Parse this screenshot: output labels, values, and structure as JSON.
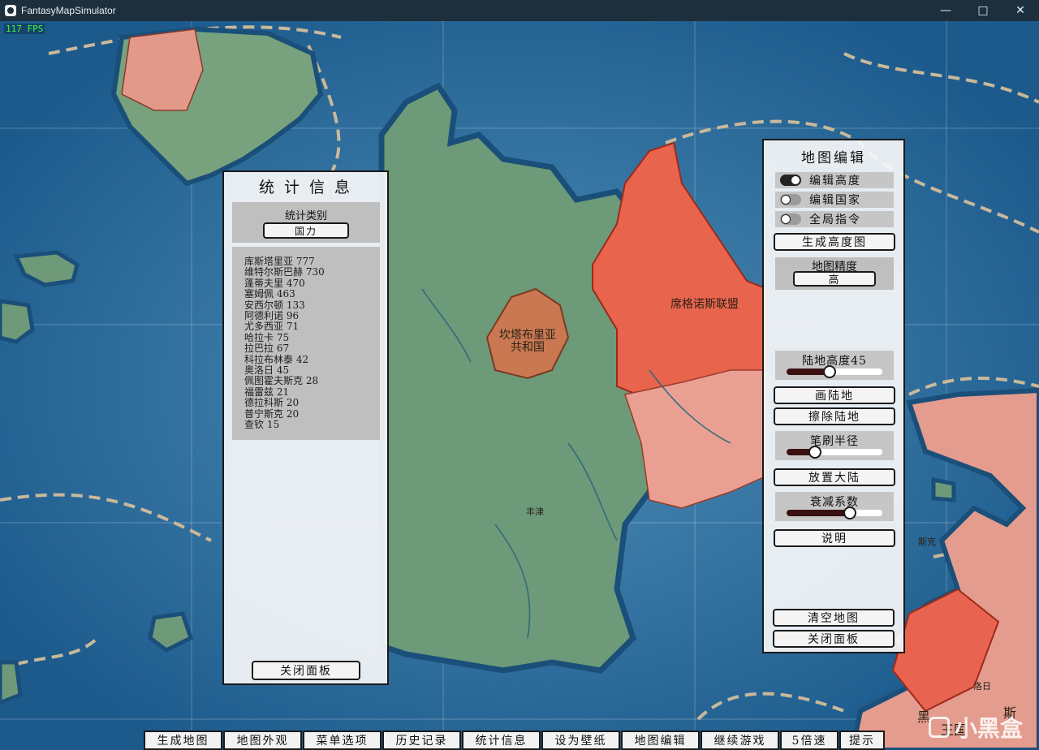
{
  "window": {
    "title": "FantasyMapSimulator"
  },
  "fps": "117 FPS",
  "map_labels": {
    "kantabuli": "坎塔布里亚共和国",
    "xigenuo": "席格诺斯联盟",
    "fengjin": "丰津",
    "kingdom": "王国",
    "kingdom_pre": "黑",
    "kingdom_post": "斯",
    "right_edge": "斯克",
    "right_city": "洛日"
  },
  "stats_panel": {
    "title": "统 计 信 息",
    "category_label": "统计类别",
    "category_value": "国力",
    "entries": [
      "库斯塔里亚 777",
      "维特尔斯巴赫 730",
      "蓬蒂夫里 470",
      "塞姆佩 463",
      "安西尔顿 133",
      "阿德利诺 96",
      "尤多西亚 71",
      "哈拉卡 75",
      "拉巴拉 67",
      "科拉布林泰 42",
      "奥洛日 45",
      "佩图霍夫斯克 28",
      "福雷兹 21",
      "德拉科斯 20",
      "普宁斯克 20",
      "查钦 15"
    ],
    "close_label": "关闭面板"
  },
  "edit_panel": {
    "title": "地图编辑",
    "toggles": [
      {
        "label": "编辑高度",
        "on": true
      },
      {
        "label": "编辑国家",
        "on": false
      },
      {
        "label": "全局指令",
        "on": false
      }
    ],
    "generate_heightmap": "生成高度图",
    "precision_label": "地图精度",
    "precision_value": "高",
    "land_height_label": "陆地高度45",
    "land_height_value": 0.45,
    "draw_land": "画陆地",
    "erase_land": "擦除陆地",
    "brush_label": "笔刷半径",
    "brush_value": 0.3,
    "place_continent": "放置大陆",
    "decay_label": "衰减系数",
    "decay_value": 0.66,
    "help": "说明",
    "clear_map": "清空地图",
    "close_label": "关闭面板"
  },
  "toolbar": [
    "生成地图",
    "地图外观",
    "菜单选项",
    "历史记录",
    "统计信息",
    "设为壁纸",
    "地图编辑",
    "继续游戏",
    "5倍速",
    "提示"
  ],
  "watermark": "小黑盒",
  "colors": {
    "ocean": "#1f5f92",
    "land_green": "#6d9a78",
    "red_nation": "#e8644d",
    "pink_nation": "#e9a092",
    "orange_nation": "#c97852"
  }
}
